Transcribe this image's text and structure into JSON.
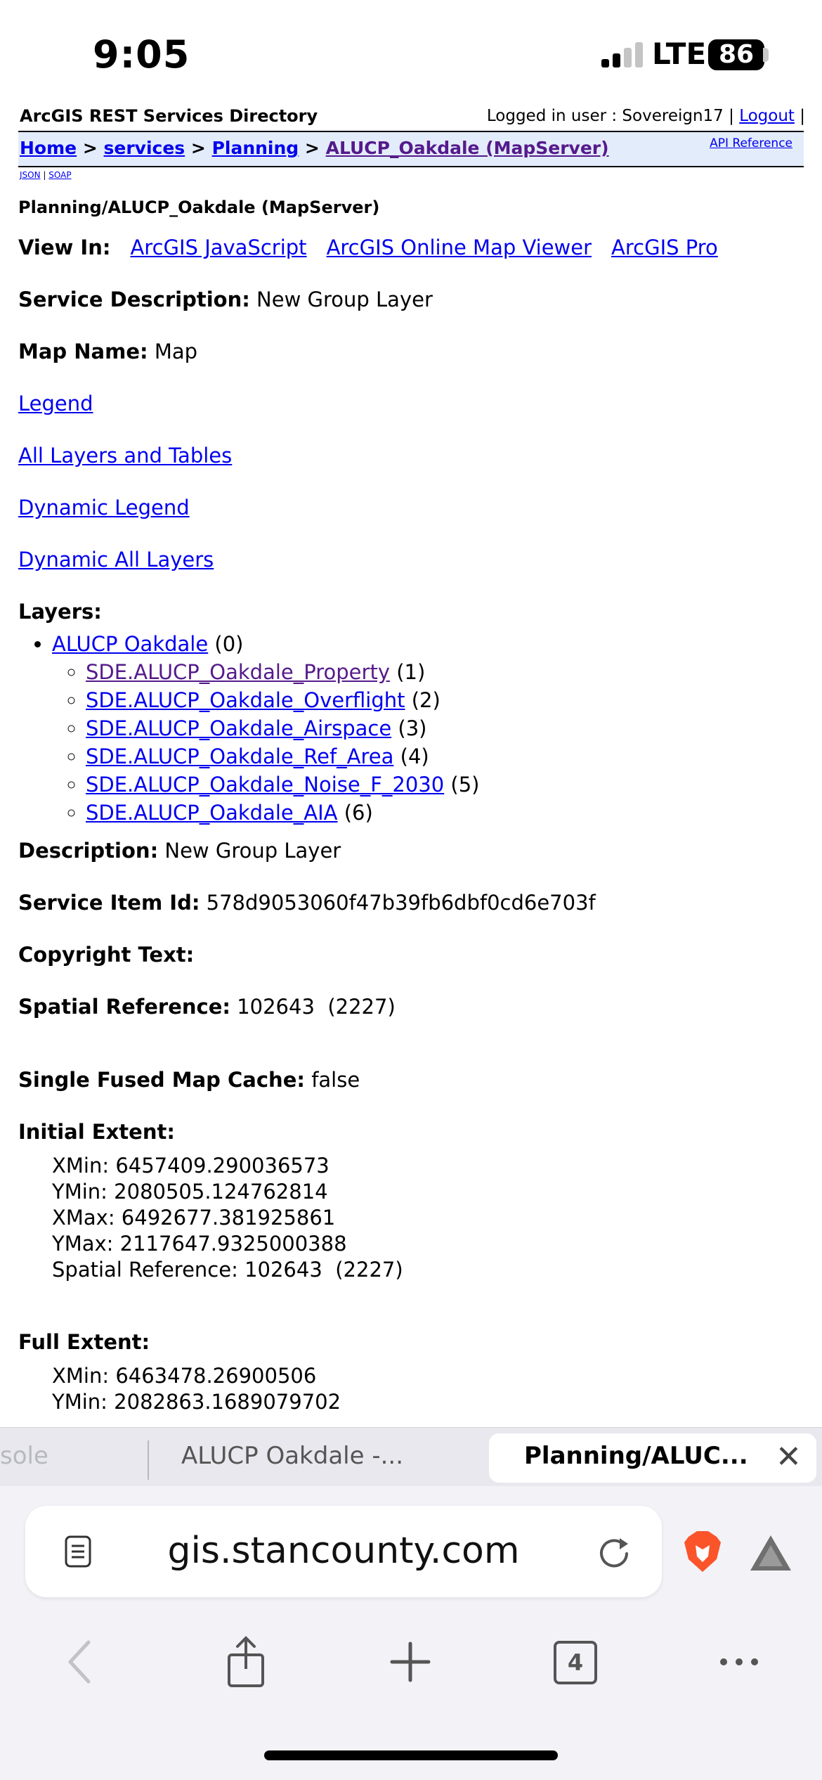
{
  "status": {
    "time": "9:05",
    "network": "LTE",
    "battery": "86"
  },
  "header": {
    "directory_title": "ArcGIS REST Services Directory",
    "logged_in_label": "Logged in user : Sovereign17 |",
    "logout": "Logout",
    "trailing_sep": "|",
    "breadcrumbs": [
      "Home",
      "services",
      "Planning",
      "ALUCP_Oakdale (MapServer)"
    ],
    "breadcrumb_sep": ">",
    "api_reference": "API Reference",
    "formats": [
      "JSON",
      "SOAP"
    ],
    "format_sep": "|"
  },
  "service": {
    "title": "Planning/ALUCP_Oakdale (MapServer)",
    "view_in_label": "View In:",
    "view_in": [
      "ArcGIS JavaScript",
      "ArcGIS Online Map Viewer",
      "ArcGIS Pro"
    ],
    "service_description_label": "Service Description:",
    "service_description": "New Group Layer",
    "map_name_label": "Map Name:",
    "map_name": "Map",
    "links": [
      "Legend",
      "All Layers and Tables",
      "Dynamic Legend",
      "Dynamic All Layers"
    ],
    "layers_label": "Layers:",
    "group_layer": {
      "name": "ALUCP Oakdale",
      "id": "(0)"
    },
    "sublayers": [
      {
        "name": "SDE.ALUCP_Oakdale_Property",
        "id": "(1)"
      },
      {
        "name": "SDE.ALUCP_Oakdale_Overflight",
        "id": "(2)"
      },
      {
        "name": "SDE.ALUCP_Oakdale_Airspace",
        "id": "(3)"
      },
      {
        "name": "SDE.ALUCP_Oakdale_Ref_Area",
        "id": "(4)"
      },
      {
        "name": "SDE.ALUCP_Oakdale_Noise_F_2030",
        "id": "(5)"
      },
      {
        "name": "SDE.ALUCP_Oakdale_AIA",
        "id": "(6)"
      }
    ],
    "description_label": "Description:",
    "description": "New Group Layer",
    "item_id_label": "Service Item Id:",
    "item_id": "578d9053060f47b39fb6dbf0cd6e703f",
    "copyright_label": "Copyright Text:",
    "spatial_ref_label": "Spatial Reference:",
    "spatial_ref": "102643  (2227)",
    "fused_cache_label": "Single Fused Map Cache:",
    "fused_cache": "false",
    "initial_extent_label": "Initial Extent:",
    "initial_extent": {
      "xmin": "XMin: 6457409.290036573",
      "ymin": "YMin: 2080505.124762814",
      "xmax": "XMax: 6492677.381925861",
      "ymax": "YMax: 2117647.9325000388",
      "sr": "Spatial Reference: 102643  (2227)"
    },
    "full_extent_label": "Full Extent:",
    "full_extent": {
      "xmin": "XMin: 6463478.26900506",
      "ymin": "YMin: 2082863.1689079702"
    }
  },
  "tabs": {
    "prev": "sole",
    "middle": "ALUCP Oakdale -...",
    "active": "Planning/ALUC..."
  },
  "browser": {
    "url": "gis.stancounty.com",
    "tab_count": "4"
  },
  "colors": {
    "link": "#0000ee",
    "visited": "#551a8b",
    "nav_bg": "#e3ecfa",
    "brave": "#fb542b"
  }
}
